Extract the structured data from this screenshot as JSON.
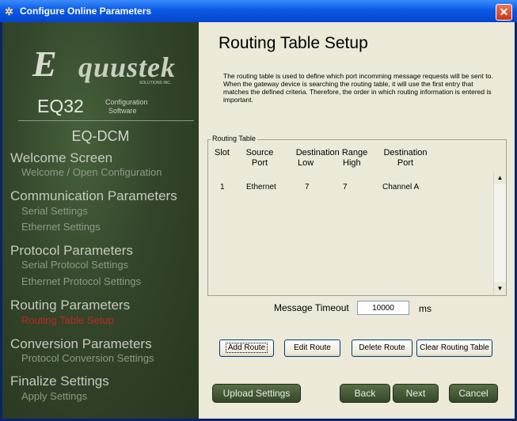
{
  "window": {
    "title": "Configure Online Parameters",
    "close_label": "✕",
    "title_icon": "gear-icon"
  },
  "sidebar": {
    "logo": {
      "q": "E",
      "word": "quustek",
      "sub": "SOLUTIONS INC."
    },
    "eq32": "EQ32",
    "config1": "Configuration",
    "config2": "Software",
    "product": "EQ-DCM",
    "sections": [
      {
        "title": "Welcome Screen",
        "items": [
          "Welcome / Open Configuration"
        ]
      },
      {
        "title": "Communication Parameters",
        "items": [
          "Serial Settings",
          "Ethernet Settings"
        ]
      },
      {
        "title": "Protocol Parameters",
        "items": [
          "Serial Protocol Settings",
          "Ethernet Protocol Settings"
        ]
      },
      {
        "title": "Routing Parameters",
        "items": [
          "Routing Table Setup"
        ]
      },
      {
        "title": "Conversion Parameters",
        "items": [
          "Protocol Conversion Settings"
        ]
      },
      {
        "title": "Finalize Settings",
        "items": [
          "Apply Settings"
        ]
      }
    ],
    "active_color": "#c0281c"
  },
  "main": {
    "heading": "Routing Table Setup",
    "description": "The routing table is used to define which port incomming message requests will be sent to.  When the gateway device is searching the routing table, it will use the first entry that matches the defined criteria.  Therefore, the order in which routing information is entered is important.",
    "group_label": "Routing Table",
    "columns": {
      "slot": "Slot",
      "source": "Source",
      "source_port": "Port",
      "dest_range": "Destination Range",
      "low": "Low",
      "high": "High",
      "destination": "Destination",
      "dest_port": "Port"
    },
    "rows": [
      {
        "slot": "1",
        "source_port": "Ethernet",
        "low": "7",
        "high": "7",
        "destination_port": "Channel A"
      }
    ],
    "timeout_label": "Message Timeout",
    "timeout_value": "10000",
    "timeout_unit": "ms",
    "buttons": {
      "add": "Add Route",
      "edit": "Edit Route",
      "delete": "Delete Route",
      "clear": "Clear Routing Table",
      "upload": "Upload Settings",
      "back": "Back",
      "next": "Next",
      "cancel": "Cancel"
    }
  }
}
